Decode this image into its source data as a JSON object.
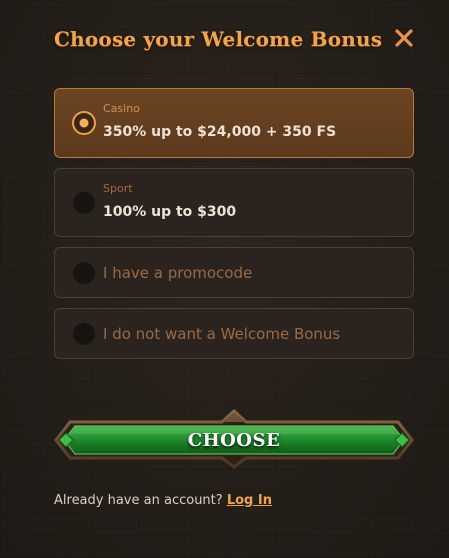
{
  "header": {
    "title": "Choose your Welcome Bonus",
    "close_icon": "close-x-icon"
  },
  "options": [
    {
      "category": "Casino",
      "label": "350% up to $24,000 + 350 FS",
      "selected": true
    },
    {
      "category": "Sport",
      "label": "100% up to $300",
      "selected": false
    },
    {
      "label": "I have a promocode",
      "selected": false
    },
    {
      "label": "I do not want a Welcome Bonus",
      "selected": false
    }
  ],
  "choose_button": {
    "label": "CHOOSE"
  },
  "footer": {
    "prompt": "Already have an account?",
    "login_label": "Log In"
  },
  "colors": {
    "accent": "#f5a447",
    "selected_bg": "#5c3a1d",
    "button_green": "#1f8a2a"
  }
}
